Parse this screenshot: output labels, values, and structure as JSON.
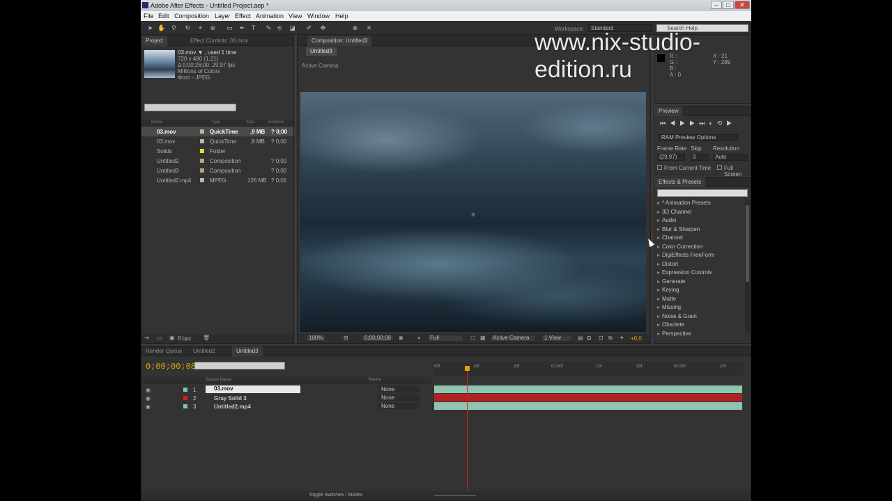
{
  "window": {
    "title": "Adobe After Effects - Untitled Project.aep *"
  },
  "menu": [
    "File",
    "Edit",
    "Composition",
    "Layer",
    "Effect",
    "Animation",
    "View",
    "Window",
    "Help"
  ],
  "toolbar": {
    "workspace_label": "Workspace:",
    "workspace_value": "Standard",
    "search_placeholder": "Search Help"
  },
  "watermark": "www.nix-studio-edition.ru",
  "project": {
    "tabs": [
      "Project",
      "Effect Controls: 03.mov"
    ],
    "info": [
      "03.mov ▼ , used 1 time",
      "720 x 480 (1,21)",
      "Δ 0;00;26;00, 29,97 fps",
      "Millions of Colors",
      "Фото - JPEG"
    ],
    "columns": [
      "Name",
      "Type",
      "Size",
      "Duration"
    ],
    "items": [
      {
        "name": "03.mov",
        "type": "QuickTime",
        "size": ",9 MB",
        "duration": "? 0;00",
        "color": "#b8b8a0"
      },
      {
        "name": "03.mov",
        "type": "QuickTime",
        "size": ",9 MB",
        "duration": "? 0;00",
        "color": "#b8b8a0"
      },
      {
        "name": "Solids",
        "type": "Folder",
        "size": "",
        "duration": "",
        "color": "#e6d630"
      },
      {
        "name": "Untitled2",
        "type": "Composition",
        "size": "",
        "duration": "? 0;00",
        "color": "#b8a080"
      },
      {
        "name": "Untitled3",
        "type": "Composition",
        "size": "",
        "duration": "? 0;00",
        "color": "#b8a080"
      },
      {
        "name": "Untitled2.mp4",
        "type": "MPEG",
        "size": "126 MB",
        "duration": "? 0;01",
        "color": "#b8b8a0"
      }
    ],
    "bpc": "8 bpc"
  },
  "composition": {
    "tab": "Composition: Untitled3",
    "subtab": "Untitled3",
    "view_label": "Active Camera",
    "footer": {
      "zoom": "100%",
      "timecode": "0;00;00;08",
      "resolution": "Full",
      "camera": "Active Camera",
      "views": "1 View",
      "offset": "+0,0"
    }
  },
  "info": {
    "r": "R :",
    "g": "G :",
    "b": "B :",
    "a": "A : 0",
    "x": "X : 21",
    "y": "Y : 289"
  },
  "preview": {
    "title": "Preview",
    "ram_options": "RAM Preview Options",
    "frame_rate_label": "Frame Rate",
    "skip_label": "Skip",
    "resolution_label": "Resolution",
    "frame_rate": "(29,97)",
    "skip": "0",
    "resolution": "Auto",
    "from_current": "From Current Time",
    "full_screen": "Full Screen"
  },
  "effects": {
    "title": "Effects & Presets",
    "items": [
      "* Animation Presets",
      "3D Channel",
      "Audio",
      "Blur & Sharpen",
      "Channel",
      "Color Correction",
      "DigiEffects FreeForm",
      "Distort",
      "Expression Controls",
      "Generate",
      "Keying",
      "Matte",
      "Missing",
      "Noise & Grain",
      "Obsolete",
      "Perspective"
    ]
  },
  "timeline": {
    "tabs": [
      "Render Queue",
      "Untitled2",
      "Untitled3"
    ],
    "timecode": "0;00;00;08",
    "columns": {
      "source": "Source Name",
      "parent": "Parent"
    },
    "ruler": [
      "00f",
      "10f",
      "20f",
      "01:00f",
      "10f",
      "20f",
      "02:00f",
      "10f"
    ],
    "layers": [
      {
        "num": "1",
        "name": "03.mov",
        "parent": "None",
        "color": "#80c8b0"
      },
      {
        "num": "2",
        "name": "Gray Solid 3",
        "parent": "None",
        "color": "#d02020"
      },
      {
        "num": "3",
        "name": "Untitled2.mp4",
        "parent": "None",
        "color": "#80c8b0"
      }
    ],
    "toggle": "Toggle Switches / Modes"
  }
}
